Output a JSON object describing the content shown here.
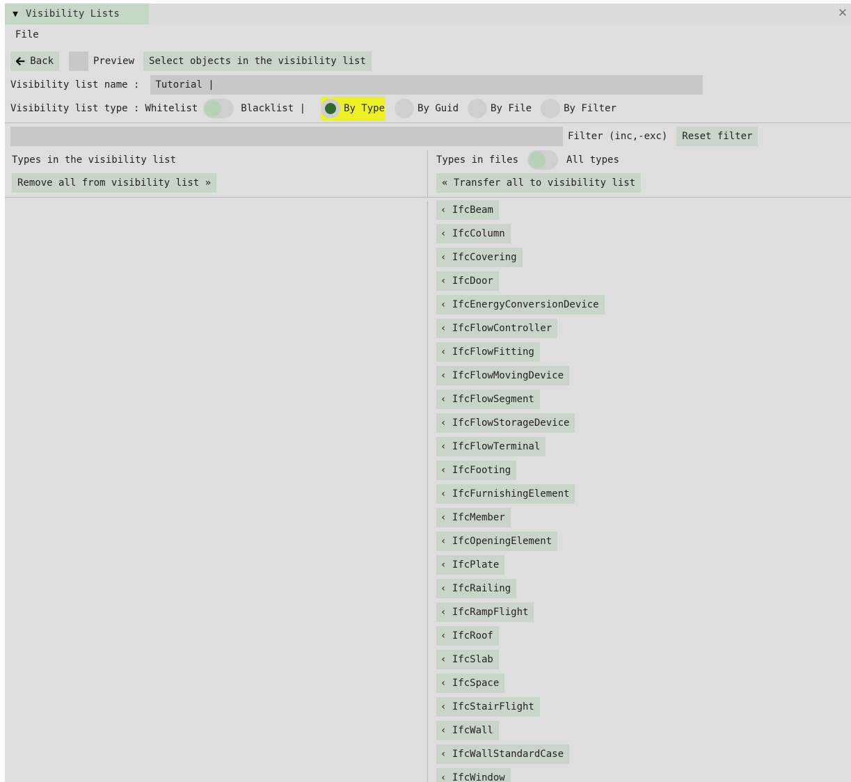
{
  "window": {
    "title": "Visibility Lists",
    "collapse_icon": "triangle-down-icon",
    "close_icon": "close-icon"
  },
  "menu": {
    "file": "File"
  },
  "toolbar": {
    "back_label": "Back",
    "back_icon": "arrow-left-icon",
    "preview_label": "Preview",
    "select_label": "Select objects in the visibility list"
  },
  "name_row": {
    "label": "Visibility list name :",
    "value": "Tutorial |"
  },
  "type_row": {
    "label": "Visibility list type :",
    "whitelist": "Whitelist",
    "blacklist": "Blacklist |",
    "modes": [
      "By Type",
      "By Guid",
      "By File",
      "By Filter"
    ],
    "selected_mode": "By Type"
  },
  "filter_row": {
    "value": "",
    "label": "Filter (inc,-exc)",
    "reset_label": "Reset filter"
  },
  "left_panel": {
    "header": "Types in the visibility list",
    "remove_all_label": "Remove all from visibility list »"
  },
  "right_panel": {
    "header": "Types in files",
    "all_types_label": "All types",
    "transfer_all_label": "« Transfer all to visibility list",
    "items": [
      "‹ IfcBeam",
      "‹ IfcColumn",
      "‹ IfcCovering",
      "‹ IfcDoor",
      "‹ IfcEnergyConversionDevice",
      "‹ IfcFlowController",
      "‹ IfcFlowFitting",
      "‹ IfcFlowMovingDevice",
      "‹ IfcFlowSegment",
      "‹ IfcFlowStorageDevice",
      "‹ IfcFlowTerminal",
      "‹ IfcFooting",
      "‹ IfcFurnishingElement",
      "‹ IfcMember",
      "‹ IfcOpeningElement",
      "‹ IfcPlate",
      "‹ IfcRailing",
      "‹ IfcRampFlight",
      "‹ IfcRoof",
      "‹ IfcSlab",
      "‹ IfcSpace",
      "‹ IfcStairFlight",
      "‹ IfcWall",
      "‹ IfcWallStandardCase",
      "‹ IfcWindow"
    ]
  },
  "colors": {
    "background": "#dedede",
    "button": "#c9d5c9",
    "input": "#c8c8c8",
    "radio_selected": "#2f6b2f",
    "highlight": "#eef026"
  }
}
